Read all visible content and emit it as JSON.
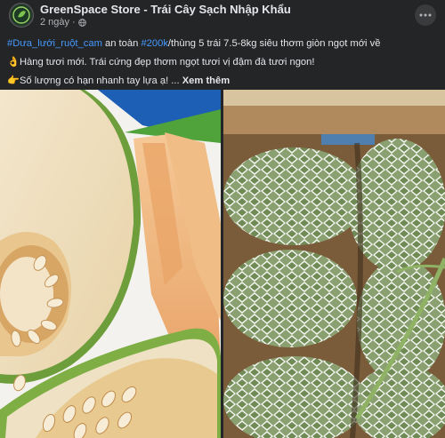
{
  "post": {
    "page_name": "GreenSpace Store - Trái Cây Sạch Nhập Khẩu",
    "time": "2 ngày",
    "dot": "·",
    "more_label": "···",
    "text": {
      "line1": {
        "hashtag1": "#Dưa_lưới_ruột_cam",
        "part1": " an toàn ",
        "hashtag2": "#200k",
        "part2": "/thùng 5 trái 7.5-8kg siêu thơm giòn ngọt mới về"
      },
      "line2": {
        "emoji": "👌",
        "text": "Hàng tươi mới. Trái cứng đẹp thơm ngọt tươi vị đậm đà tươi ngon!"
      },
      "line3": {
        "emoji": "👉",
        "text": "Số lượng có hạn nhanh tay lựa ạ! ... ",
        "see_more": "Xem thêm"
      }
    }
  },
  "icons": {
    "avatar": "greenspace-logo",
    "privacy": "globe-icon",
    "more": "more-horizontal-icon"
  },
  "colors": {
    "background": "#242526",
    "text": "#e4e6eb",
    "secondary_text": "#b0b3b8",
    "hashtag": "#4599ff"
  },
  "photos": [
    {
      "subject": "cut-cantaloupe-melon"
    },
    {
      "subject": "whole-melons-in-foam-net-box"
    }
  ]
}
